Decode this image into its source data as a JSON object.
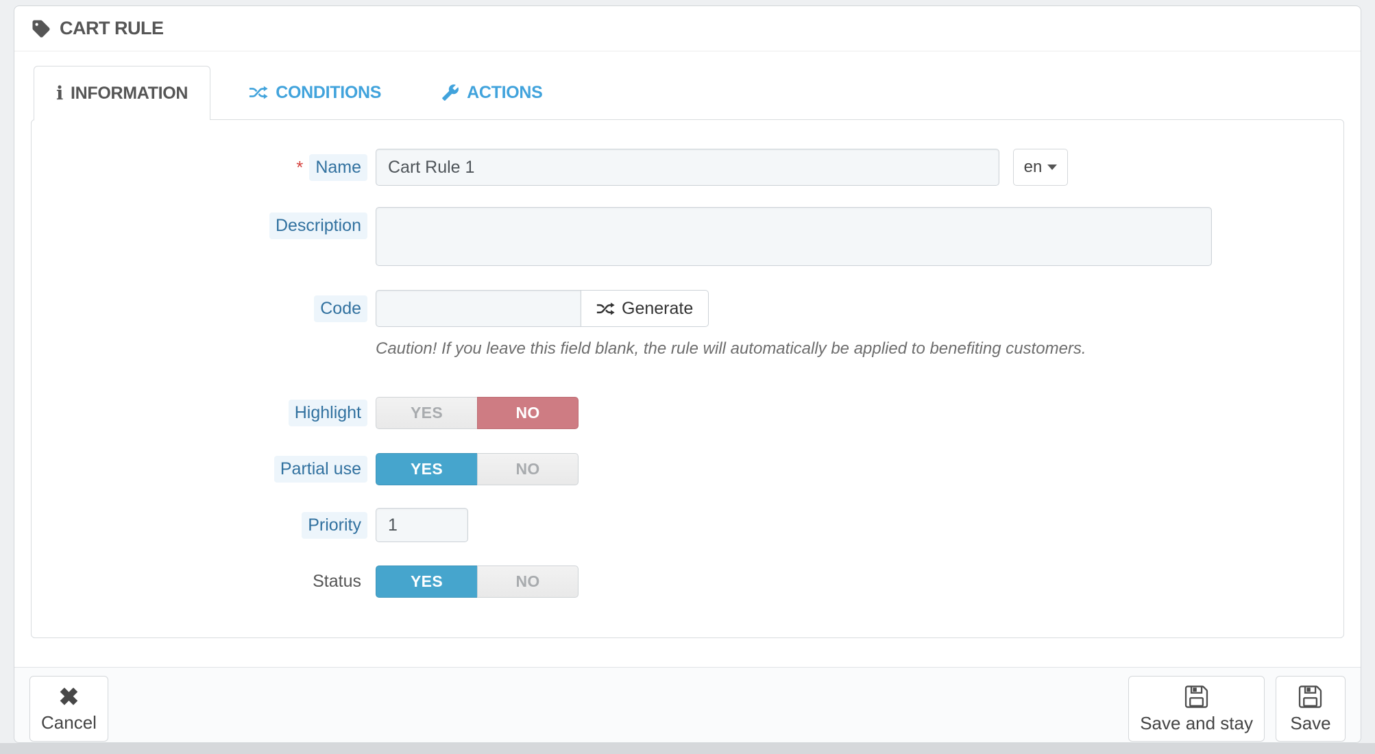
{
  "panel": {
    "title": "CART RULE"
  },
  "tabs": [
    {
      "label": "INFORMATION",
      "active": true
    },
    {
      "label": "CONDITIONS",
      "active": false
    },
    {
      "label": "ACTIONS",
      "active": false
    }
  ],
  "form": {
    "required_marker": "*",
    "name": {
      "label": "Name",
      "value": "Cart Rule 1",
      "lang": "en"
    },
    "description": {
      "label": "Description",
      "value": ""
    },
    "code": {
      "label": "Code",
      "value": "",
      "generate_label": "Generate",
      "caution": "Caution! If you leave this field blank, the rule will automatically be applied to benefiting customers."
    },
    "highlight": {
      "label": "Highlight",
      "selected": "NO"
    },
    "partial_use": {
      "label": "Partial use",
      "selected": "YES"
    },
    "priority": {
      "label": "Priority",
      "value": "1"
    },
    "status": {
      "label": "Status",
      "selected": "YES"
    },
    "toggle": {
      "yes": "YES",
      "no": "NO"
    }
  },
  "footer": {
    "cancel": "Cancel",
    "save_and_stay": "Save and stay",
    "save": "Save"
  },
  "colors": {
    "accent_blue": "#46a5cd",
    "tab_blue": "#41a3dc",
    "danger_red": "#ce7c83",
    "label_blue": "#31719f",
    "label_bg": "#edf5fb",
    "panel_bg": "#ffffff",
    "page_bg": "#eef0f2"
  }
}
